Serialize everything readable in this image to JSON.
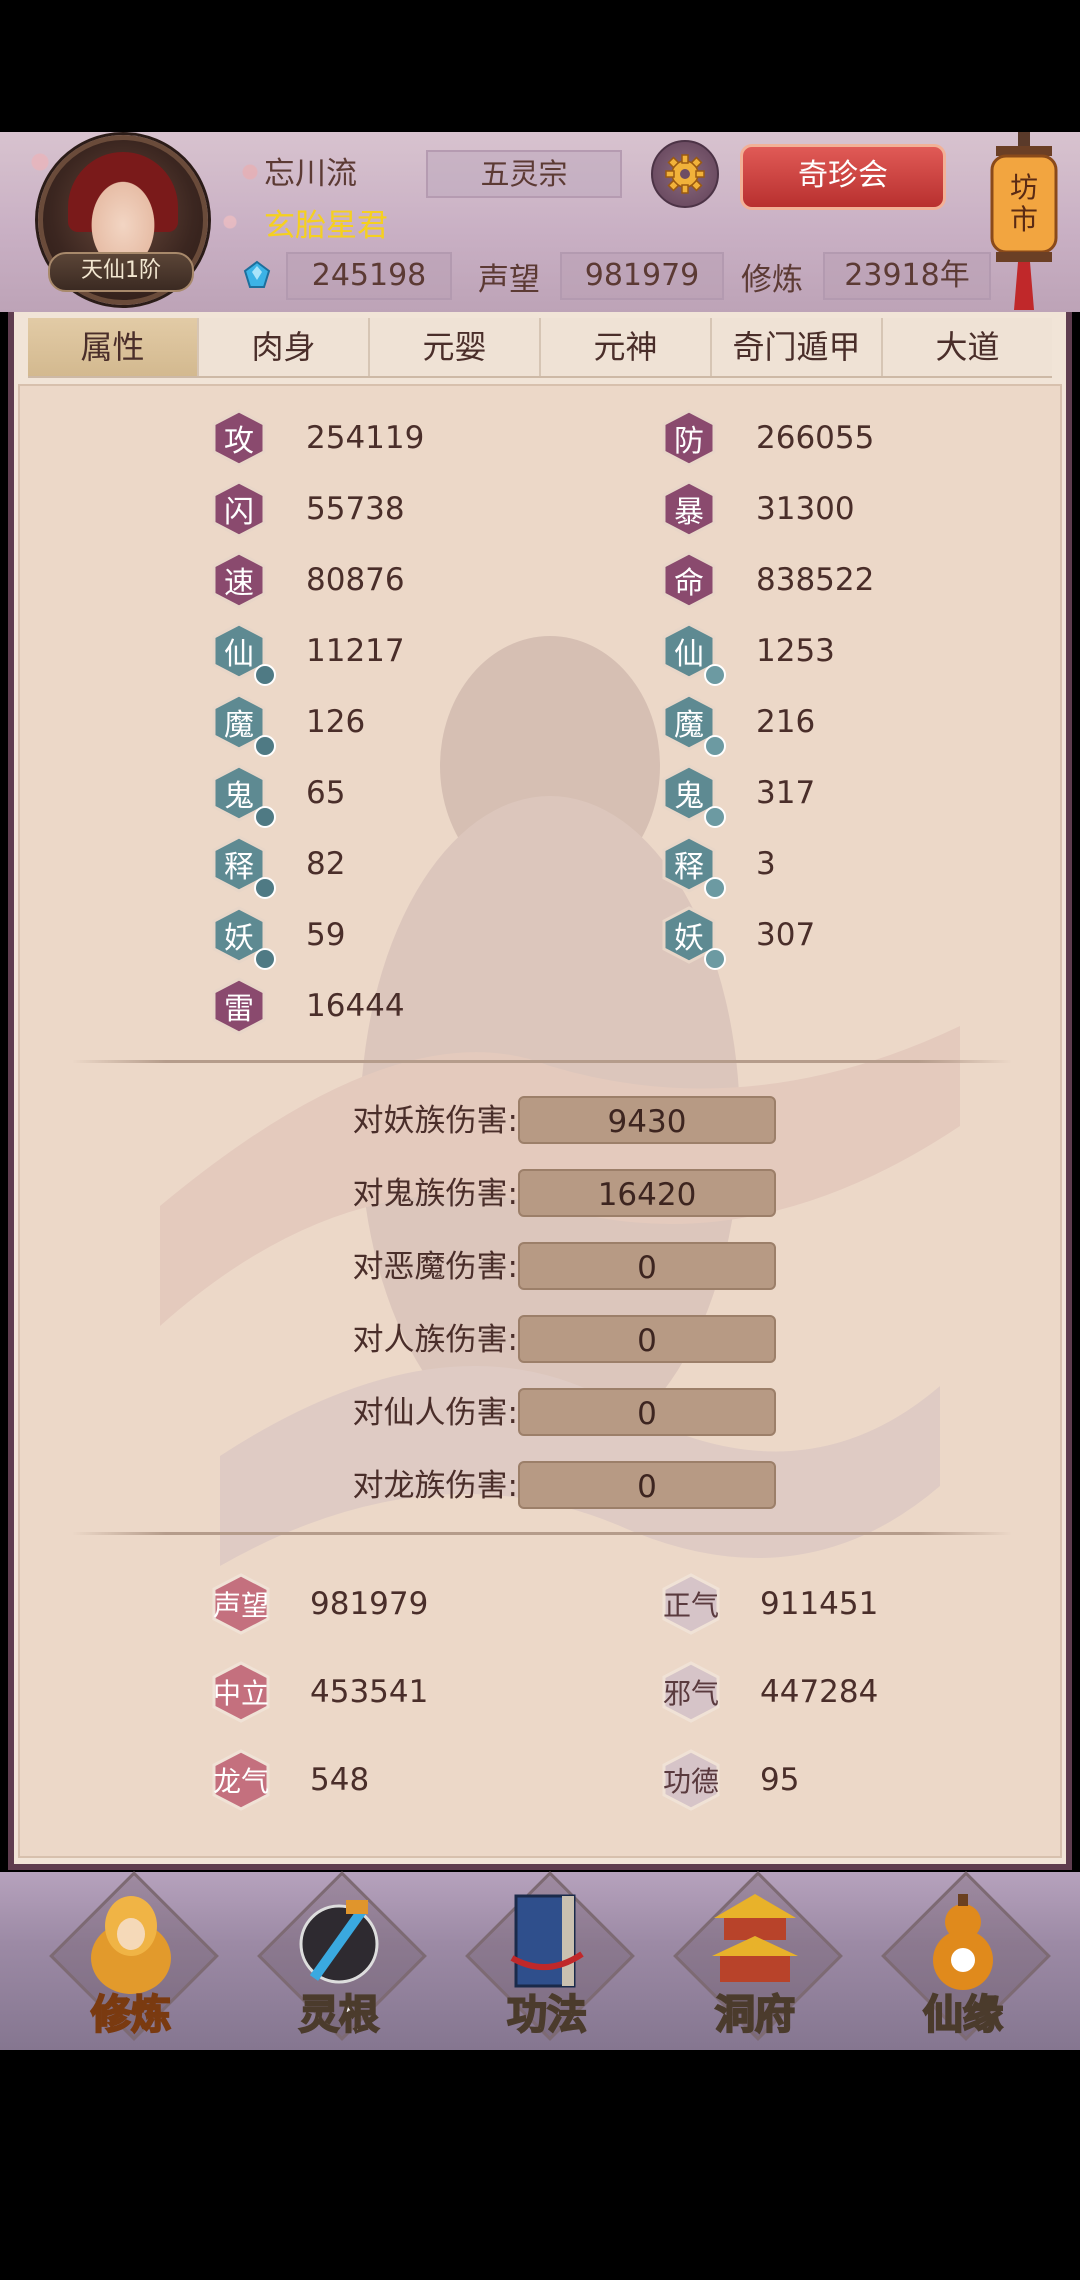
{
  "header": {
    "player_name": "忘川流",
    "player_title": "玄胎星君",
    "sect": "五灵宗",
    "rank_badge": "天仙1阶",
    "treasure_button": "奇珍会",
    "market_button": "坊市",
    "spirit_stones": "245198",
    "reputation_label": "声望",
    "reputation_value": "981979",
    "cultivation_label": "修炼",
    "cultivation_value": "23918年",
    "icons": [
      "gear-icon",
      "spirit-stone-icon",
      "lantern-icon"
    ]
  },
  "tabs": [
    {
      "label": "属性",
      "active": true
    },
    {
      "label": "肉身"
    },
    {
      "label": "元婴"
    },
    {
      "label": "元神"
    },
    {
      "label": "奇门遁甲"
    },
    {
      "label": "大道"
    }
  ],
  "stats_left": [
    {
      "glyph": "攻",
      "value": "254119",
      "color": "#8a4a6e"
    },
    {
      "glyph": "闪",
      "value": "55738",
      "color": "#8a4a6e"
    },
    {
      "glyph": "速",
      "value": "80876",
      "color": "#8a4a6e"
    },
    {
      "glyph": "仙",
      "value": "11217",
      "color": "#5e8a92",
      "badge": "#4f7a84"
    },
    {
      "glyph": "魔",
      "value": "126",
      "color": "#5e8a92",
      "badge": "#4f7a84"
    },
    {
      "glyph": "鬼",
      "value": "65",
      "color": "#5e8a92",
      "badge": "#4f7a84"
    },
    {
      "glyph": "释",
      "value": "82",
      "color": "#5e8a92",
      "badge": "#4f7a84"
    },
    {
      "glyph": "妖",
      "value": "59",
      "color": "#5e8a92",
      "badge": "#4f7a84"
    },
    {
      "glyph": "雷",
      "value": "16444",
      "color": "#8a4a6e"
    }
  ],
  "stats_right": [
    {
      "glyph": "防",
      "value": "266055",
      "color": "#8a4a6e"
    },
    {
      "glyph": "暴",
      "value": "31300",
      "color": "#8a4a6e"
    },
    {
      "glyph": "命",
      "value": "838522",
      "color": "#8a4a6e"
    },
    {
      "glyph": "仙",
      "value": "1253",
      "color": "#5e8a92",
      "badge": "#6c9aa2"
    },
    {
      "glyph": "魔",
      "value": "216",
      "color": "#5e8a92",
      "badge": "#6c9aa2"
    },
    {
      "glyph": "鬼",
      "value": "317",
      "color": "#5e8a92",
      "badge": "#6c9aa2"
    },
    {
      "glyph": "释",
      "value": "3",
      "color": "#5e8a92",
      "badge": "#6c9aa2"
    },
    {
      "glyph": "妖",
      "value": "307",
      "color": "#5e8a92",
      "badge": "#6c9aa2"
    }
  ],
  "damage_bonuses": [
    {
      "label": "对妖族伤害:",
      "value": "9430"
    },
    {
      "label": "对鬼族伤害:",
      "value": "16420"
    },
    {
      "label": "对恶魔伤害:",
      "value": "0"
    },
    {
      "label": "对人族伤害:",
      "value": "0"
    },
    {
      "label": "对仙人伤害:",
      "value": "0"
    },
    {
      "label": "对龙族伤害:",
      "value": "0"
    }
  ],
  "attributes": [
    {
      "label": "声望",
      "value": "981979",
      "color": "#c4707e"
    },
    {
      "label": "正气",
      "value": "911451",
      "color": "#d6c4c8"
    },
    {
      "label": "中立",
      "value": "453541",
      "color": "#c4707e"
    },
    {
      "label": "邪气",
      "value": "447284",
      "color": "#d6c4c8"
    },
    {
      "label": "龙气",
      "value": "548",
      "color": "#c4707e"
    },
    {
      "label": "功德",
      "value": "95",
      "color": "#d6c4c8"
    }
  ],
  "bottom_nav": [
    {
      "label": "修炼",
      "active": true,
      "icon": "cultivator-icon"
    },
    {
      "label": "灵根",
      "icon": "sword-root-icon"
    },
    {
      "label": "功法",
      "icon": "book-icon"
    },
    {
      "label": "洞府",
      "icon": "pagoda-icon"
    },
    {
      "label": "仙缘",
      "icon": "gourd-icon"
    }
  ],
  "colors": {
    "accent_gold": "#f5d020",
    "panel_bg": "#ecd8c8",
    "frame": "#5f3d4f",
    "treasure_red": "#c8403e"
  }
}
